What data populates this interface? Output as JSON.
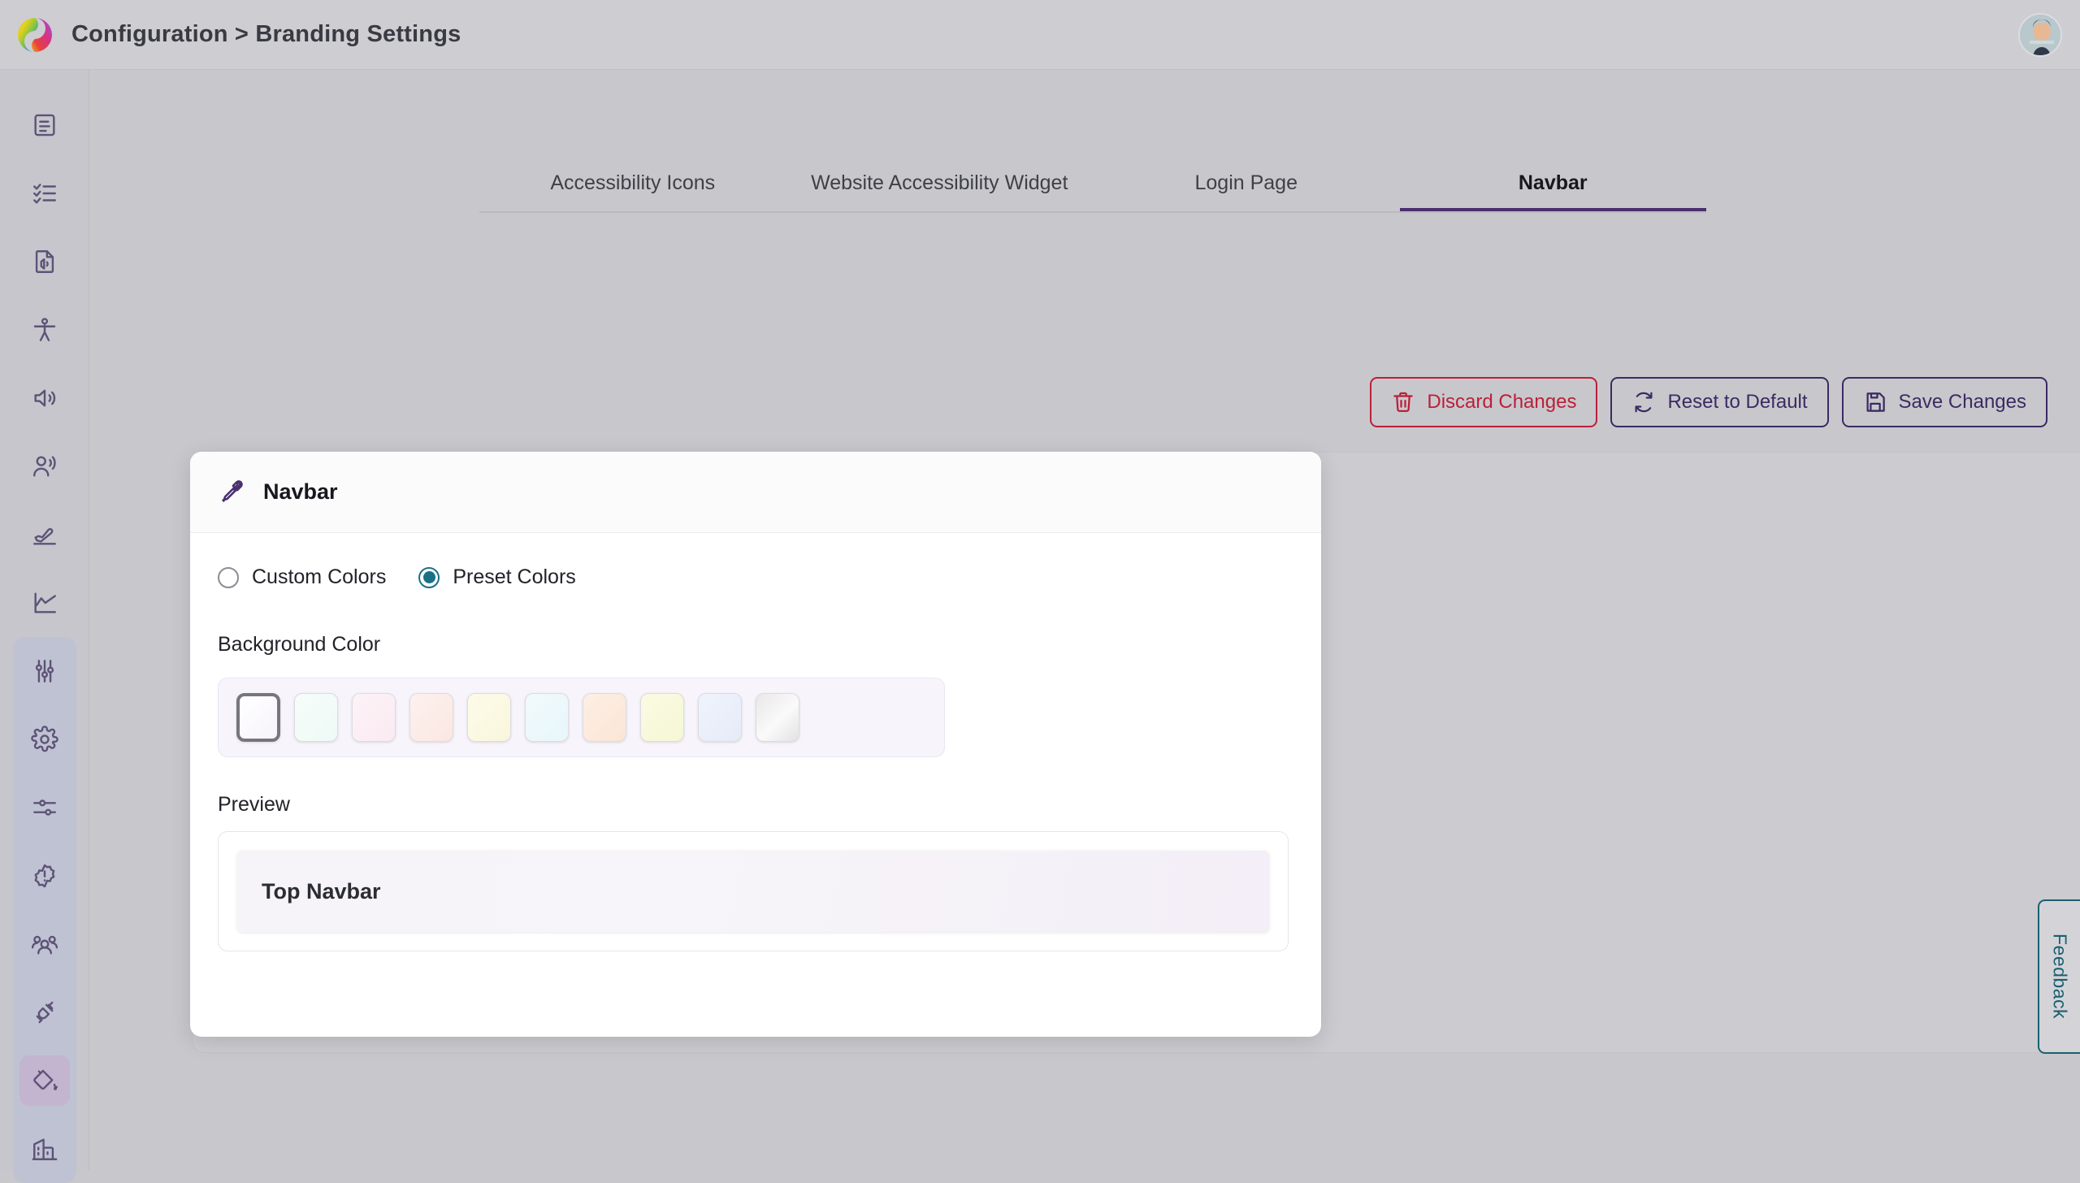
{
  "header": {
    "logo_icon": "brand-swirl-logo",
    "breadcrumb": "Configuration > Branding Settings",
    "avatar_icon": "user-avatar-photo"
  },
  "sidebar": {
    "groups": [
      {
        "shaded": false,
        "items": [
          {
            "icon": "document-report-icon",
            "name": "sidebar-item-reports",
            "active": false
          },
          {
            "icon": "checklist-icon",
            "name": "sidebar-item-tasks",
            "active": false
          },
          {
            "icon": "audio-file-icon",
            "name": "sidebar-item-audio-files",
            "active": false
          },
          {
            "icon": "accessibility-person-icon",
            "name": "sidebar-item-accessibility",
            "active": false
          },
          {
            "icon": "speaker-volume-icon",
            "name": "sidebar-item-audio",
            "active": false
          },
          {
            "icon": "person-speaking-icon",
            "name": "sidebar-item-voice",
            "active": false
          },
          {
            "icon": "airplane-takeoff-icon",
            "name": "sidebar-item-launch",
            "active": false
          },
          {
            "icon": "chart-line-icon",
            "name": "sidebar-item-analytics",
            "active": false
          }
        ]
      },
      {
        "shaded": true,
        "items": [
          {
            "icon": "sliders-vertical-icon",
            "name": "sidebar-item-controls",
            "active": false
          },
          {
            "icon": "gear-icon",
            "name": "sidebar-item-settings",
            "active": false
          },
          {
            "icon": "sliders-horizontal-icon",
            "name": "sidebar-item-preferences",
            "active": false
          },
          {
            "icon": "alert-badge-icon",
            "name": "sidebar-item-alerts",
            "active": false
          },
          {
            "icon": "users-group-icon",
            "name": "sidebar-item-users",
            "active": false
          },
          {
            "icon": "plug-connection-icon",
            "name": "sidebar-item-integrations",
            "active": false
          },
          {
            "icon": "paint-bucket-icon",
            "name": "sidebar-item-branding",
            "active": true
          },
          {
            "icon": "building-icon",
            "name": "sidebar-item-organization",
            "active": false
          }
        ]
      }
    ]
  },
  "tabs": [
    {
      "label": "Accessibility Icons",
      "active": false
    },
    {
      "label": "Website Accessibility Widget",
      "active": false
    },
    {
      "label": "Login Page",
      "active": false
    },
    {
      "label": "Navbar",
      "active": true
    }
  ],
  "actions": [
    {
      "label": "Discard Changes",
      "icon": "trash-icon",
      "style": "danger",
      "color": "#bb1f3a"
    },
    {
      "label": "Reset to Default",
      "icon": "refresh-icon",
      "style": "primary",
      "color": "#3c2a63"
    },
    {
      "label": "Save Changes",
      "icon": "save-disk-icon",
      "style": "primary",
      "color": "#3c2a63"
    }
  ],
  "card": {
    "icon": "eyedropper-icon",
    "title": "Navbar",
    "color_mode": {
      "options": [
        {
          "label": "Custom Colors",
          "selected": false
        },
        {
          "label": "Preset Colors",
          "selected": true
        }
      ],
      "selected_color": "#1a7087"
    },
    "background_color": {
      "label": "Background Color",
      "selected_index": 0,
      "swatches": [
        {
          "name": "swatch-white-lavender",
          "css": "linear-gradient(135deg,#ffffff 0%,#f7f3fa 100%)",
          "selected": true
        },
        {
          "name": "swatch-mint",
          "css": "linear-gradient(135deg,#f6fcfa 0%,#eefaf5 100%)",
          "selected": false
        },
        {
          "name": "swatch-pink",
          "css": "linear-gradient(135deg,#fdf3f7 0%,#faeaf1 100%)",
          "selected": false
        },
        {
          "name": "swatch-blush",
          "css": "linear-gradient(135deg,#fdf1ee 0%,#fbe7e2 100%)",
          "selected": false
        },
        {
          "name": "swatch-cream",
          "css": "linear-gradient(135deg,#fdfbe9 0%,#faf6dc 100%)",
          "selected": false
        },
        {
          "name": "swatch-ice-blue",
          "css": "linear-gradient(135deg,#f1fafc 0%,#e8f6fa 100%)",
          "selected": false
        },
        {
          "name": "swatch-apricot",
          "css": "linear-gradient(135deg,#fdefe4 0%,#fbe5d5 100%)",
          "selected": false
        },
        {
          "name": "swatch-pale-yellow",
          "css": "linear-gradient(135deg,#fafbe3 0%,#f5f7d4 100%)",
          "selected": false
        },
        {
          "name": "swatch-periwinkle",
          "css": "linear-gradient(135deg,#f0f3fc 0%,#e6ebf8 100%)",
          "selected": false
        },
        {
          "name": "swatch-gray",
          "css": "linear-gradient(135deg,#e8e8e8 0%,#fafafa 55%,#e2e2e2 100%)",
          "selected": false
        }
      ]
    },
    "preview": {
      "label": "Preview",
      "navbar_text": "Top Navbar",
      "navbar_css": "linear-gradient(100deg,#f6f4f8 0%,#f7f5f9 45%,#f3eef7 100%)"
    }
  },
  "feedback": {
    "label": "Feedback",
    "color": "#1a6070"
  }
}
